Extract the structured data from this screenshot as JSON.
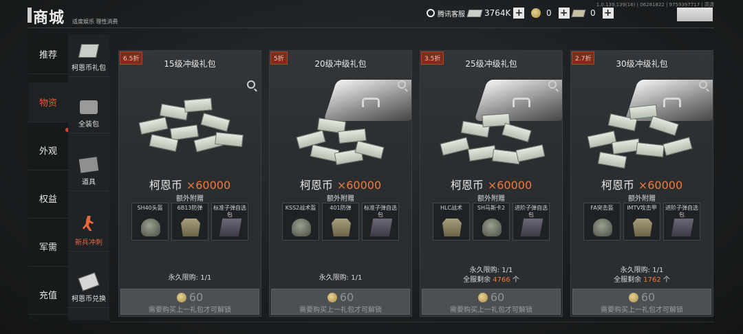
{
  "header": {
    "title": "商城",
    "subtitle": "适度娱乐 理性消费",
    "version": "1.0.139.139(16) | 06281822 | 9759397717 | 高清",
    "service_label": "腾讯客服",
    "currencies": [
      {
        "icon": "bill-icon",
        "value": "3764K"
      },
      {
        "icon": "coin-icon",
        "value": "0"
      },
      {
        "icon": "ticket-icon",
        "value": "0"
      }
    ]
  },
  "nav": [
    {
      "label": "推荐"
    },
    {
      "label": "物资"
    },
    {
      "label": "外观"
    },
    {
      "label": "权益"
    },
    {
      "label": "军需"
    },
    {
      "label": "充值"
    }
  ],
  "subnav": [
    {
      "label": "柯恩币礼包",
      "icon": "bills-icon"
    },
    {
      "label": "全装包",
      "icon": "box-icon"
    },
    {
      "label": "道具",
      "icon": "items-icon"
    },
    {
      "label": "新兵冲刺",
      "icon": "runner-icon"
    },
    {
      "label": "柯恩币兑换",
      "icon": "exchange-icon"
    }
  ],
  "cards": [
    {
      "discount": "6.5折",
      "title": "15级冲级礼包",
      "currency": "柯恩币",
      "qty": "×60000",
      "bonus_label": "额外附赠",
      "bonus": [
        "SH40头盔",
        "6B13防弹",
        "标准子弹自选包"
      ],
      "limit": "永久限购: 1/1",
      "price": "60",
      "lock": "需要购买上一礼包才可解锁"
    },
    {
      "discount": "5折",
      "title": "20级冲级礼包",
      "currency": "柯恩币",
      "qty": "×60000",
      "bonus_label": "额外附赠",
      "bonus": [
        "KSS2战术盔",
        "401防弹",
        "标准子弹自选包"
      ],
      "limit": "永久限购: 1/1",
      "price": "60",
      "lock": "需要购买上一礼包才可解锁"
    },
    {
      "discount": "3.5折",
      "title": "25级冲级礼包",
      "currency": "柯恩币",
      "qty": "×60000",
      "bonus_label": "额外附赠",
      "bonus": [
        "HLC战术",
        "SH马斯卡2",
        "进阶子弹自选包"
      ],
      "limit": "永久限购: 1/1",
      "remain_label": "全服剩余",
      "remain_num": "4766",
      "remain_unit": "个",
      "price": "60",
      "lock": "需要购买上一礼包才可解锁"
    },
    {
      "discount": "2.7折",
      "title": "30级冲级礼包",
      "currency": "柯恩币",
      "qty": "×60000",
      "bonus_label": "额外附赠",
      "bonus": [
        "FA突击盔",
        "IMTV攻击甲",
        "进阶子弹自选包"
      ],
      "limit": "永久限购: 1/1",
      "remain_label": "全服剩余",
      "remain_num": "1762",
      "remain_unit": "个",
      "price": "60",
      "lock": "需要购买上一礼包才可解锁"
    }
  ]
}
